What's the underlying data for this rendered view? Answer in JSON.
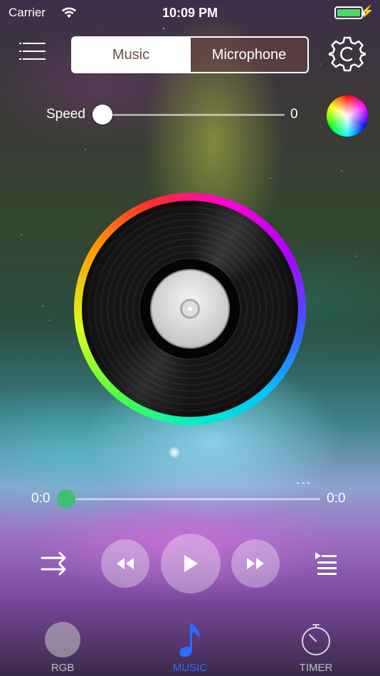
{
  "status_bar": {
    "carrier": "Carrier",
    "time": "10:09 PM",
    "battery_level": 1.0,
    "battery_color": "#4cd964"
  },
  "header": {
    "menu_icon": "hamburger-menu-icon",
    "segments": [
      {
        "label": "Music",
        "selected": true
      },
      {
        "label": "Microphone",
        "selected": false
      }
    ],
    "settings_icon": "gear-icon"
  },
  "speed": {
    "label": "Speed",
    "value": "0"
  },
  "color_picker_icon": "color-wheel-icon",
  "player": {
    "track_name": "---",
    "elapsed": "0:0",
    "duration": "0:0",
    "progress": 0,
    "accent_color": "#3fbf74",
    "controls": {
      "shuffle_icon": "shuffle-icon",
      "rewind_icon": "rewind-icon",
      "play_icon": "play-icon",
      "forward_icon": "fast-forward-icon",
      "playlist_icon": "playlist-icon"
    }
  },
  "tabs": [
    {
      "label": "RGB",
      "icon": "rgb-circle-icon",
      "active": false
    },
    {
      "label": "MUSIC",
      "icon": "music-note-icon",
      "active": true,
      "color": "#2b6bff"
    },
    {
      "label": "TIMER",
      "icon": "timer-icon",
      "active": false
    }
  ]
}
